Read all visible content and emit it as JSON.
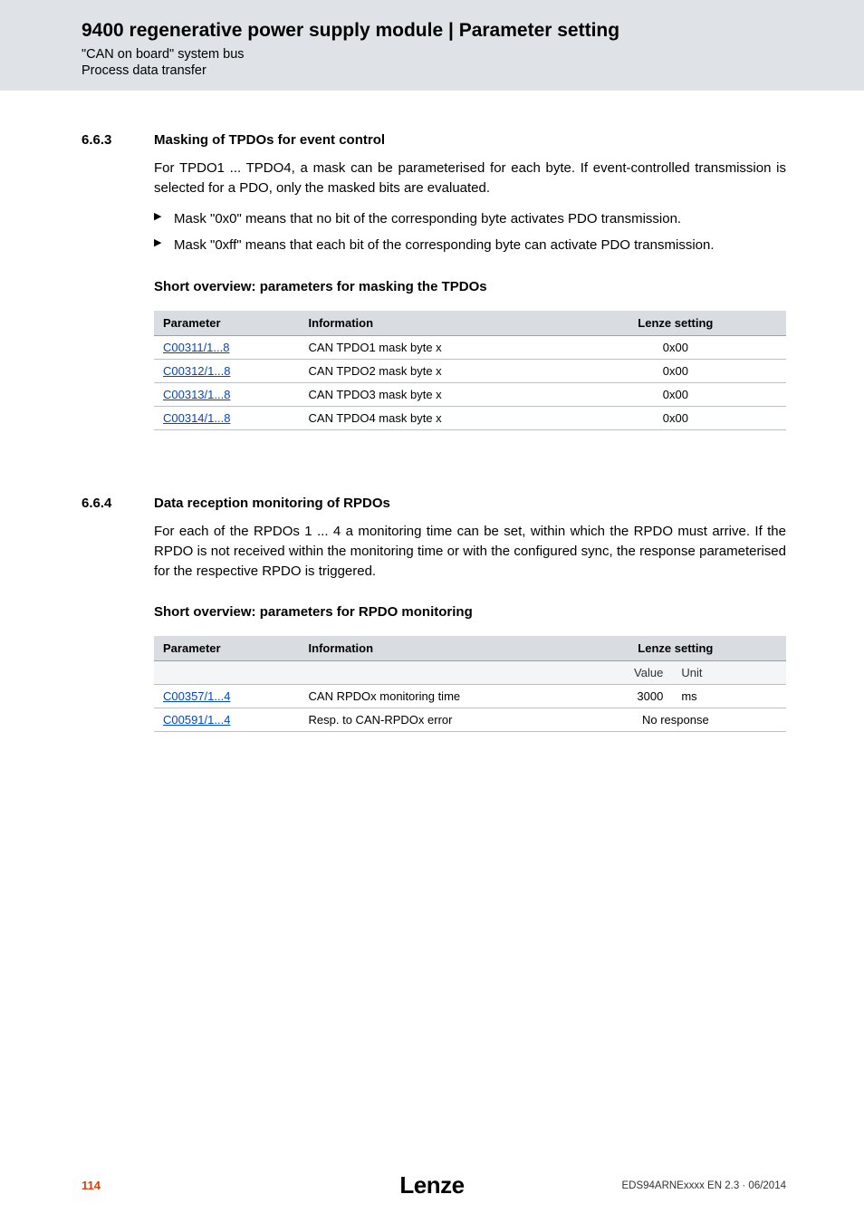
{
  "header": {
    "title": "9400 regenerative power supply module | Parameter setting",
    "sub1": "\"CAN on board\" system bus",
    "sub2": "Process data transfer"
  },
  "section1": {
    "num": "6.6.3",
    "title": "Masking of TPDOs for event control",
    "para1": "For TPDO1 ... TPDO4, a mask can be parameterised for each byte. If event-controlled transmission is selected for a PDO, only the masked bits are evaluated.",
    "bullet1": "Mask \"0x0\" means that no bit of the corresponding byte activates PDO transmission.",
    "bullet2": "Mask \"0xff\" means that each bit of the corresponding byte can activate PDO transmission.",
    "subhead": "Short overview: parameters for masking the TPDOs",
    "th": {
      "param": "Parameter",
      "info": "Information",
      "setting": "Lenze setting"
    },
    "rows": [
      {
        "param": "C00311/1...8",
        "info": "CAN TPDO1 mask byte x",
        "setting": "0x00"
      },
      {
        "param": "C00312/1...8",
        "info": "CAN TPDO2 mask byte x",
        "setting": "0x00"
      },
      {
        "param": "C00313/1...8",
        "info": "CAN TPDO3 mask byte x",
        "setting": "0x00"
      },
      {
        "param": "C00314/1...8",
        "info": "CAN TPDO4 mask byte x",
        "setting": "0x00"
      }
    ]
  },
  "section2": {
    "num": "6.6.4",
    "title": "Data reception monitoring of RPDOs",
    "para1": "For each of the RPDOs 1 ... 4 a monitoring time can be set, within which the RPDO must arrive. If the RPDO is not received within the monitoring time or with the configured sync, the response parameterised for the respective RPDO is triggered.",
    "subhead": "Short overview: parameters for RPDO monitoring",
    "th": {
      "param": "Parameter",
      "info": "Information",
      "setting": "Lenze setting",
      "value": "Value",
      "unit": "Unit"
    },
    "rows": [
      {
        "param": "C00357/1...4",
        "info": "CAN RPDOx monitoring time",
        "value": "3000",
        "unit": "ms"
      },
      {
        "param": "C00591/1...4",
        "info": "Resp. to CAN-RPDOx error",
        "combined": "No response"
      }
    ]
  },
  "footer": {
    "page": "114",
    "brand": "Lenze",
    "docid": "EDS94ARNExxxx EN 2.3 · 06/2014"
  }
}
